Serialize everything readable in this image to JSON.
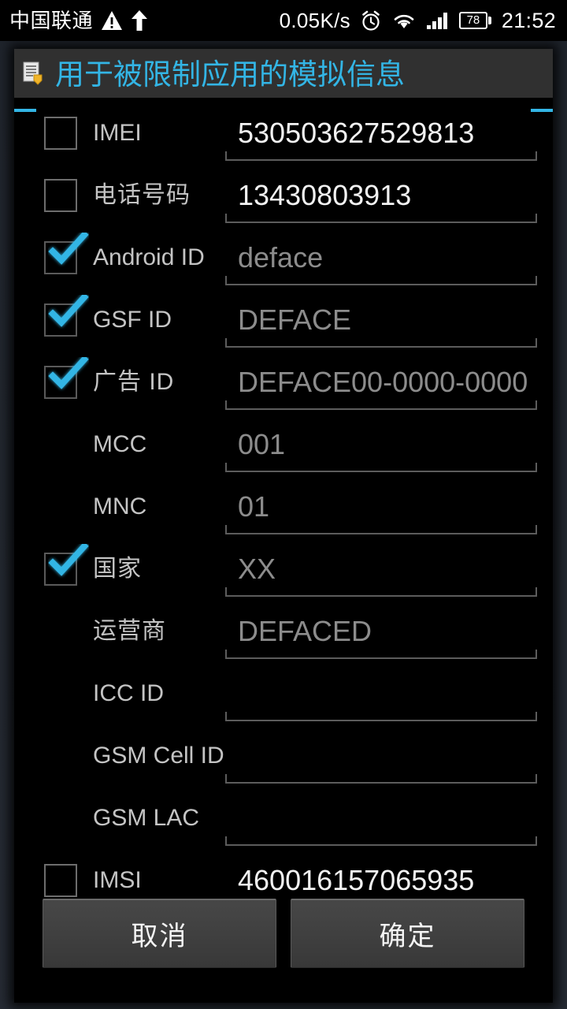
{
  "status_bar": {
    "carrier": "中国联通",
    "warning_icon": "warning-triangle-icon",
    "upload_icon": "upload-arrow-icon",
    "network_speed": "0.05K/s",
    "alarm_icon": "alarm-clock-icon",
    "wifi_icon": "wifi-icon",
    "signal_icon": "cellular-signal-icon",
    "battery_level": "78",
    "time": "21:52"
  },
  "dialog": {
    "icon": "document-badge-icon",
    "title": "用于被限制应用的模拟信息",
    "accent_color": "#33b5e5",
    "rows": [
      {
        "id": "imei",
        "label": "IMEI",
        "has_checkbox": true,
        "checked": false,
        "value": "530503627529813",
        "value_style": "filled"
      },
      {
        "id": "phone",
        "label": "电话号码",
        "has_checkbox": true,
        "checked": false,
        "value": "13430803913",
        "value_style": "filled"
      },
      {
        "id": "android-id",
        "label": "Android ID",
        "has_checkbox": true,
        "checked": true,
        "value": "deface",
        "value_style": "hint"
      },
      {
        "id": "gsf-id",
        "label": "GSF ID",
        "has_checkbox": true,
        "checked": true,
        "value": "DEFACE",
        "value_style": "hint"
      },
      {
        "id": "ad-id",
        "label": "广告 ID",
        "has_checkbox": true,
        "checked": true,
        "value": "DEFACE00-0000-0000",
        "value_style": "hint"
      },
      {
        "id": "mcc",
        "label": "MCC",
        "has_checkbox": false,
        "checked": false,
        "value": "001",
        "value_style": "hint"
      },
      {
        "id": "mnc",
        "label": "MNC",
        "has_checkbox": false,
        "checked": false,
        "value": "01",
        "value_style": "hint"
      },
      {
        "id": "country",
        "label": "国家",
        "has_checkbox": true,
        "checked": true,
        "value": "XX",
        "value_style": "hint"
      },
      {
        "id": "operator",
        "label": "运营商",
        "has_checkbox": false,
        "checked": false,
        "value": "DEFACED",
        "value_style": "hint"
      },
      {
        "id": "icc-id",
        "label": "ICC ID",
        "has_checkbox": false,
        "checked": false,
        "value": "",
        "value_style": "hint"
      },
      {
        "id": "gsm-cell-id",
        "label": "GSM Cell ID",
        "has_checkbox": false,
        "checked": false,
        "value": "",
        "value_style": "hint"
      },
      {
        "id": "gsm-lac",
        "label": "GSM LAC",
        "has_checkbox": false,
        "checked": false,
        "value": "",
        "value_style": "hint"
      },
      {
        "id": "imsi",
        "label": "IMSI",
        "has_checkbox": true,
        "checked": false,
        "value": "460016157065935",
        "value_style": "filled"
      }
    ],
    "buttons": {
      "cancel": "取消",
      "confirm": "确定"
    }
  }
}
